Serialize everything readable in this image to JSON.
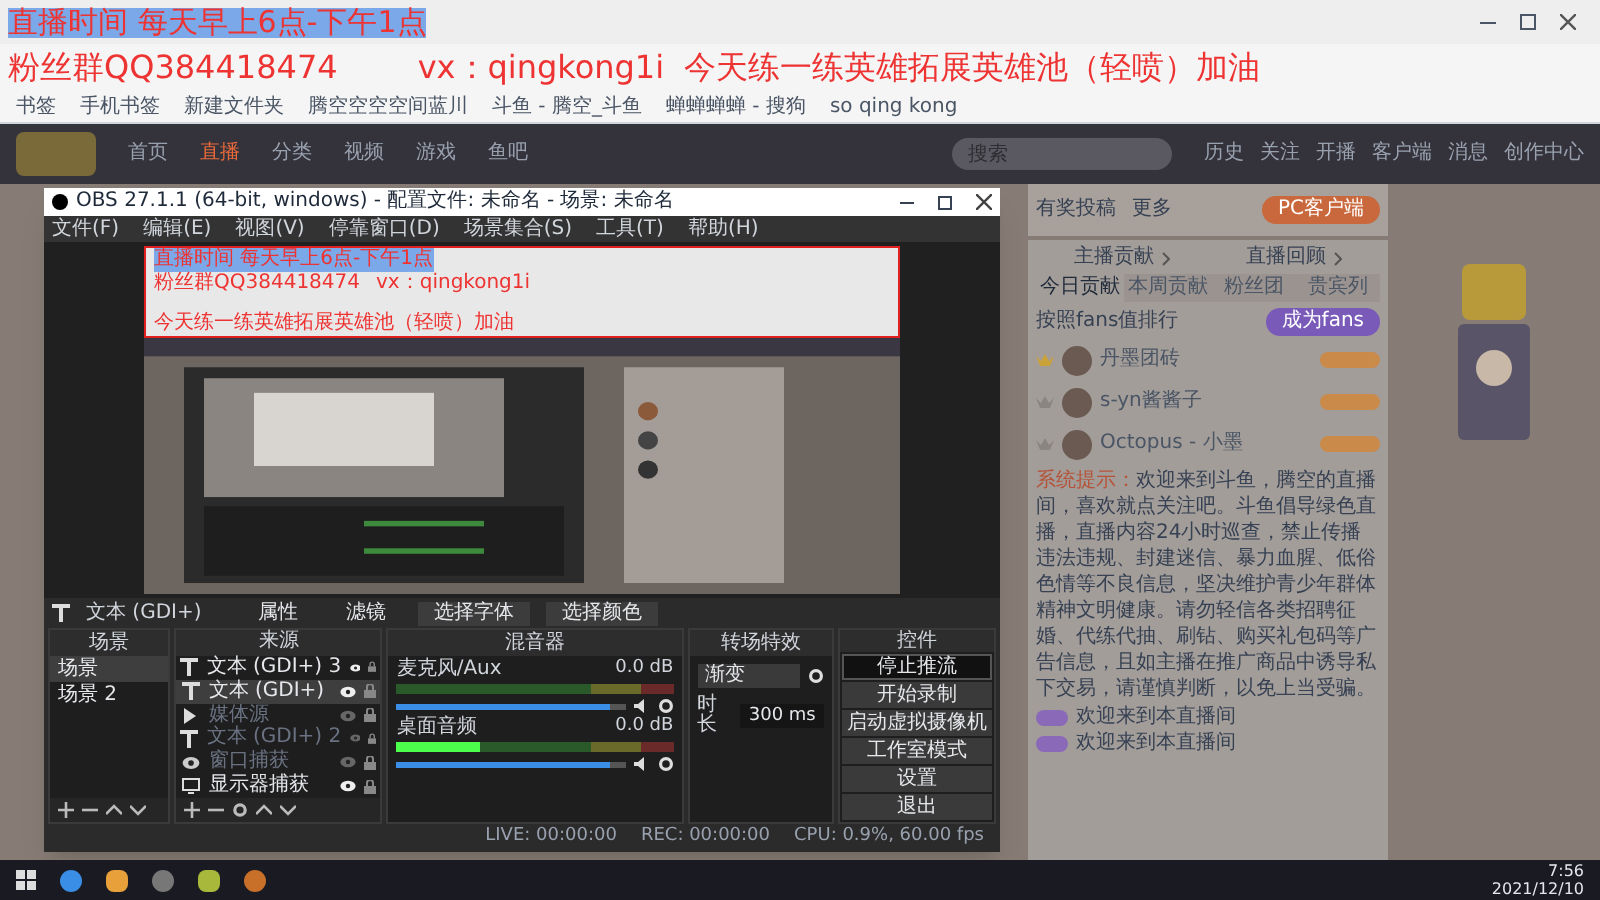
{
  "overlay": {
    "schedule": "直播时间 每天早上6点-下午1点",
    "fan_group": "粉丝群QQ384418474",
    "wechat": "vx：qingkong1i",
    "motto": "今天练一练英雄拓展英雄池（轻喷）加油"
  },
  "bookmarks": [
    "书签",
    "手机书签",
    "新建文件夹",
    "腾空空空空间蓝川",
    "斗鱼 - 腾空_斗鱼",
    "蝉蝉蝉蝉 - 搜狗",
    "so qing kong"
  ],
  "site_nav": {
    "items": [
      {
        "label": "首页",
        "selected": false
      },
      {
        "label": "直播",
        "selected": true
      },
      {
        "label": "分类",
        "selected": false
      },
      {
        "label": "视频",
        "selected": false
      },
      {
        "label": "游戏",
        "selected": false
      },
      {
        "label": "鱼吧",
        "selected": false
      }
    ],
    "search": {
      "placeholder": "搜索"
    },
    "actions": [
      "历史",
      "关注",
      "开播",
      "客户端",
      "消息",
      "创作中心"
    ]
  },
  "preview_overlay": {
    "schedule": "直播时间 每天早上6点-下午1点",
    "fan_group": "粉丝群QQ384418474",
    "wechat": "vx：qingkong1i",
    "motto": "今天练一练英雄拓展英雄池（轻喷）加油"
  },
  "obs": {
    "title": "OBS 27.1.1 (64-bit, windows) - 配置文件: 未命名 - 场景: 未命名",
    "menu": [
      "文件(F)",
      "编辑(E)",
      "视图(V)",
      "停靠窗口(D)",
      "场景集合(S)",
      "工具(T)",
      "帮助(H)"
    ],
    "source_bar": {
      "source": "文本 (GDI+)",
      "buttons": [
        "属性",
        "滤镜",
        "选择字体",
        "选择颜色"
      ]
    },
    "scenes": {
      "title": "场景",
      "items": [
        {
          "label": "场景",
          "selected": true
        },
        {
          "label": "场景 2",
          "selected": false
        }
      ]
    },
    "sources": {
      "title": "来源",
      "items": [
        {
          "kind": "text",
          "label": "文本 (GDI+) 3",
          "visible": true,
          "selected": false
        },
        {
          "kind": "text",
          "label": "文本 (GDI+)",
          "visible": true,
          "selected": true
        },
        {
          "kind": "media",
          "label": "媒体源",
          "visible": false,
          "selected": false
        },
        {
          "kind": "text",
          "label": "文本 (GDI+) 2",
          "visible": false,
          "selected": false
        },
        {
          "kind": "window",
          "label": "窗口捕获",
          "visible": false,
          "selected": false
        },
        {
          "kind": "display",
          "label": "显示器捕获",
          "visible": true,
          "selected": false
        }
      ]
    },
    "mixer": {
      "title": "混音器",
      "channels": [
        {
          "name": "麦克风/Aux",
          "reading": "0.0 dB",
          "meter": {
            "level": 0
          },
          "volume": {
            "level": 0.93
          }
        },
        {
          "name": "桌面音频",
          "reading": "0.0 dB",
          "meter": {
            "level": 0.3
          },
          "volume": {
            "level": 0.93
          }
        }
      ]
    },
    "transitions": {
      "title": "转场特效",
      "type": "渐变",
      "duration_label": "时长",
      "duration": "300 ms"
    },
    "controls": {
      "title": "控件",
      "buttons": [
        {
          "label": "停止推流",
          "active": true
        },
        {
          "label": "开始录制",
          "active": false
        },
        {
          "label": "启动虚拟摄像机",
          "active": false
        },
        {
          "label": "工作室模式",
          "active": false
        },
        {
          "label": "设置",
          "active": false
        },
        {
          "label": "退出",
          "active": false
        }
      ]
    },
    "status": {
      "live": "LIVE: 00:00:00",
      "rec": "REC: 00:00:00",
      "cpu": "CPU: 0.9%, 60.00 fps"
    }
  },
  "chat": {
    "top_actions": [
      "有奖投稿",
      "更多"
    ],
    "client_button": "PC客户端",
    "links": [
      "主播贡献",
      "直播回顾"
    ],
    "tabs": [
      {
        "label": "今日贡献",
        "selected": true
      },
      {
        "label": "本周贡献",
        "selected": false
      },
      {
        "label": "粉丝团",
        "selected": false
      },
      {
        "label": "贵宾列",
        "selected": false
      }
    ],
    "rank_title": "按照fans值排行",
    "rank_button": "成为fans",
    "ranking": [
      {
        "name": "丹墨团砖"
      },
      {
        "name": "s-yn酱酱子"
      },
      {
        "name": "Octopus - 小墨"
      }
    ],
    "system_label": "系统提示：",
    "system_text": "欢迎来到斗鱼，腾空的直播间，喜欢就点关注吧。斗鱼倡导绿色直播，直播内容24小时巡查，禁止传播违法违规、封建迷信、暴力血腥、低俗色情等不良信息，坚决维护青少年群体精神文明健康。请勿轻信各类招聘征婚、代练代抽、刷钻、购买礼包码等广告信息，且如主播在推广商品中诱导私下交易，请谨慎判断，以免上当受骗。",
    "messages": [
      {
        "text": "欢迎来到本直播间"
      },
      {
        "text": "欢迎来到本直播间"
      }
    ]
  },
  "taskbar": {
    "time": "7:56",
    "date": "2021/12/10"
  }
}
